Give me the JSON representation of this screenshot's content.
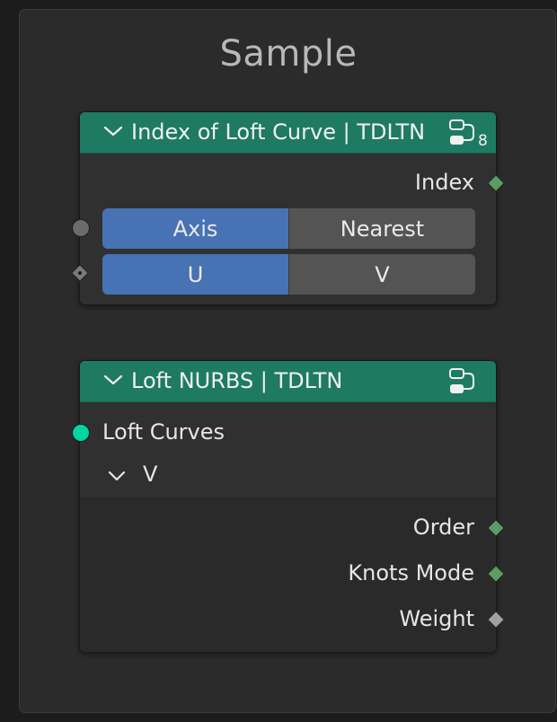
{
  "frame": {
    "title": "Sample"
  },
  "node_index": {
    "title": "Index of Loft Curve | TDLTN",
    "badge": "8",
    "outputs": [
      {
        "label": "Index",
        "socket_color": "#5e9a64"
      }
    ],
    "axis_toggle": {
      "options": [
        "Axis",
        "Nearest"
      ],
      "selected": "Axis"
    },
    "uv_toggle": {
      "options": [
        "U",
        "V"
      ],
      "selected": "U"
    }
  },
  "node_loft": {
    "title": "Loft NURBS | TDLTN",
    "inputs": [
      {
        "label": "Loft Curves",
        "socket_color": "#00d6a3"
      }
    ],
    "panel": {
      "label": "V",
      "expanded": true
    },
    "outputs": [
      {
        "label": "Order",
        "socket_color": "#5e9a64"
      },
      {
        "label": "Knots Mode",
        "socket_color": "#5e9a64"
      },
      {
        "label": "Weight",
        "socket_color": "#a1a1a1"
      }
    ]
  },
  "colors": {
    "header": "#1e7a63",
    "active_toggle": "#4772b3",
    "inactive_toggle": "#545454",
    "node_body": "#303030"
  }
}
